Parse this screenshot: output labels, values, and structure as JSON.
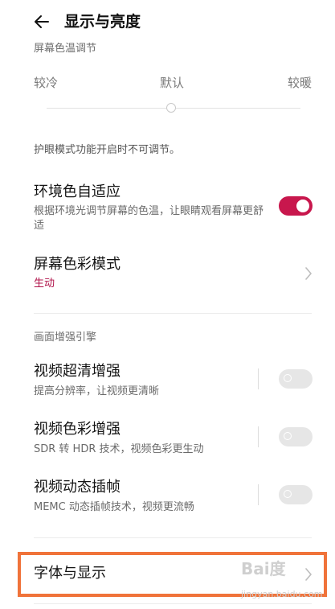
{
  "header": {
    "title": "显示与亮度",
    "back_icon": "arrow-left-icon"
  },
  "color_temperature": {
    "section_label": "屏幕色温调节",
    "cooler": "较冷",
    "default": "默认",
    "warmer": "较暖",
    "slider_position": 0.5,
    "note": "护眼模式功能开启时不可调节。"
  },
  "ambient_adaptive": {
    "title": "环境色自适应",
    "subtitle": "根据环境光调节屏幕的色温，让眼睛观看屏幕更舒适",
    "enabled": true
  },
  "color_mode": {
    "title": "屏幕色彩模式",
    "value": "生动"
  },
  "enhance_engine": {
    "section_label": "画面增强引擎",
    "items": [
      {
        "title": "视频超清增强",
        "subtitle": "提高分辨率，让视频更清晰",
        "enabled": false
      },
      {
        "title": "视频色彩增强",
        "subtitle": "SDR 转 HDR 技术，视频色彩更生动",
        "enabled": false
      },
      {
        "title": "视频动态插帧",
        "subtitle": "MEMC 动态插帧技术，视频更流畅",
        "enabled": false
      }
    ]
  },
  "font_display": {
    "title": "字体与显示"
  },
  "watermark": {
    "logo": "Bai度",
    "url": "jingyan.baidu.com"
  },
  "colors": {
    "accent": "#c8174d",
    "highlight": "#f0733a"
  }
}
